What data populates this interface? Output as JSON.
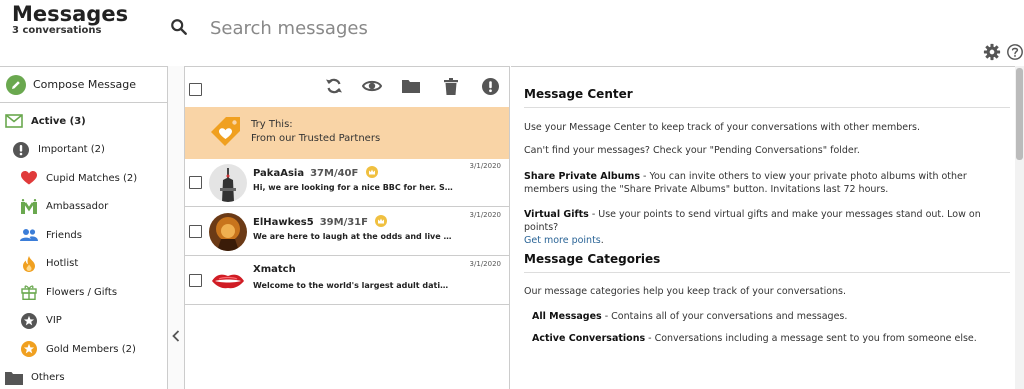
{
  "header": {
    "title": "Messages",
    "subtitle": "3 conversations",
    "search_placeholder": "Search messages"
  },
  "sidebar": {
    "compose_label": "Compose Message",
    "items": [
      {
        "label": "Active (3)",
        "icon": "envelope-icon",
        "color": "#6aa84f"
      },
      {
        "label": "Important (2)",
        "icon": "exclamation-icon",
        "color": "#555555"
      },
      {
        "label": "Cupid Matches (2)",
        "icon": "heart-icon",
        "color": "#e03a3a"
      },
      {
        "label": "Ambassador",
        "icon": "ambassador-icon",
        "color": "#6aa84f"
      },
      {
        "label": "Friends",
        "icon": "friends-icon",
        "color": "#3b7dd8"
      },
      {
        "label": "Hotlist",
        "icon": "flame-icon",
        "color": "#f0a020"
      },
      {
        "label": "Flowers / Gifts",
        "icon": "gift-icon",
        "color": "#6aa84f"
      },
      {
        "label": "VIP",
        "icon": "vip-star-icon",
        "color": "#555555"
      },
      {
        "label": "Gold Members (2)",
        "icon": "gold-star-icon",
        "color": "#f0a020"
      },
      {
        "label": "Others",
        "icon": "folder-icon",
        "color": "#555555"
      }
    ]
  },
  "promo": {
    "line1": "Try This:",
    "line2": "From our Trusted Partners"
  },
  "messages": [
    {
      "name": "PakaAsia",
      "info": "37M/40F",
      "preview": "Hi, we are looking for a nice BBC for her. She is very",
      "date": "3/1/2020"
    },
    {
      "name": "ElHawkes5",
      "info": "39M/31F",
      "preview": "We are here to laugh at the odds and live our lives so",
      "date": "3/1/2020"
    },
    {
      "name": "Xmatch",
      "info": "",
      "preview": "Welcome to the world's largest adult dating site!",
      "date": "3/1/2020"
    }
  ],
  "info": {
    "center_title": "Message Center",
    "center_p1": "Use your Message Center to keep track of your conversations with other members.",
    "center_p2": "Can't find your messages? Check your \"Pending Conversations\" folder.",
    "albums_title": "Share Private Albums",
    "albums_text": " - You can invite others to view your private photo albums with other members using the \"Share Private Albums\" button. Invitations last 72 hours.",
    "gifts_title": "Virtual Gifts",
    "gifts_text": " - Use your points to send virtual gifts and make your messages stand out. Low on points?",
    "gifts_link": "Get more points",
    "gifts_period": ".",
    "categories_title": "Message Categories",
    "categories_p": "Our message categories help you keep track of your conversations.",
    "all_title": "All Messages",
    "all_text": " - Contains all of your conversations and messages.",
    "active_title": "Active Conversations",
    "active_text": " - Conversations including a message sent to you from someone else."
  },
  "colors": {
    "accent_green": "#6aa84f",
    "promo_bg": "#f9d4a6",
    "link": "#2a6496"
  }
}
